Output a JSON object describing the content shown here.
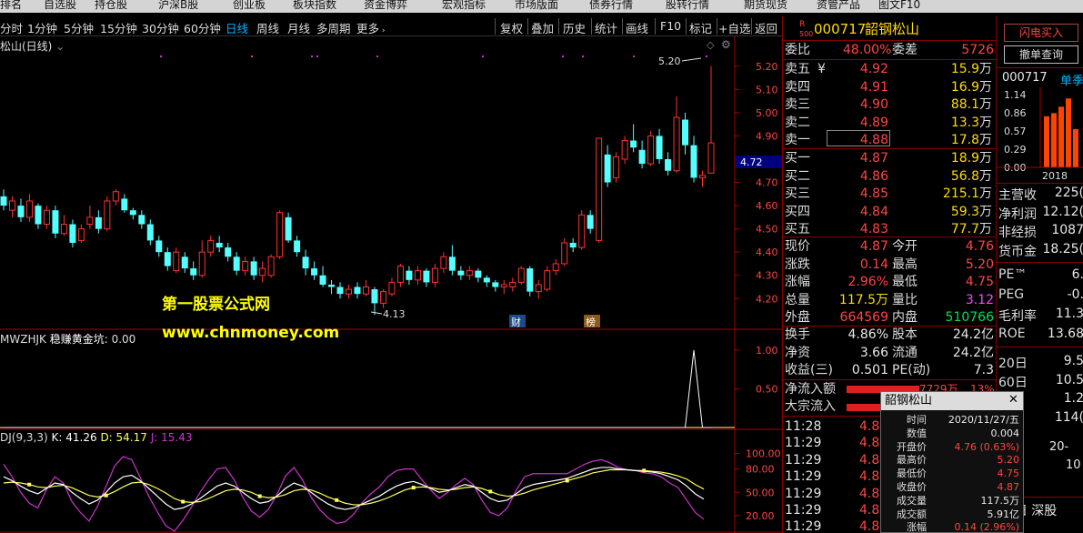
{
  "menubar": {
    "items": [
      "自选股",
      "持仓股",
      "沪深B股",
      "创业板",
      "板块指数",
      "资金博弈",
      "宏观指标",
      "市场版面",
      "债券行情",
      "股转行情",
      "期货现货",
      "资管产品",
      "图文F10"
    ],
    "left_partial": "排名"
  },
  "tabs": {
    "periods": [
      "分时",
      "1分钟",
      "5分钟",
      "15分钟",
      "30分钟",
      "60分钟",
      "日线",
      "周线",
      "月线",
      "多周期",
      "更多"
    ],
    "active": "日线",
    "tools": [
      "复权",
      "叠加",
      "历史",
      "统计",
      "画线",
      "F10",
      "标记",
      "+自选",
      "返回"
    ]
  },
  "chart_header": {
    "name": "松山(日线)"
  },
  "watermark": {
    "line1": "第一股票公式网",
    "line2": "www.chnmoney.com"
  },
  "indicator": {
    "name": "MWZHJK",
    "label": "稳赚黄金坑:",
    "value": "0.00",
    "axis": [
      "1.00",
      "0.50"
    ]
  },
  "kdj": {
    "name": "DJ(9,3,3)",
    "k": "K: 41.26",
    "d": "D: 54.17",
    "j": "J: 15.43",
    "axis": [
      "100.00",
      "80.00",
      "50.00",
      "20.00"
    ]
  },
  "chart_data": {
    "type": "candlestick",
    "price_axis": [
      "5.20",
      "5.10",
      "5.00",
      "4.90",
      "4.80",
      "4.70",
      "4.60",
      "4.50",
      "4.40",
      "4.30",
      "4.20"
    ],
    "ylim": [
      4.115,
      5.25
    ],
    "high_label": "5.20",
    "low_label": "4.13",
    "current_marker": "4.72",
    "event_badges": [
      "财",
      "榜"
    ],
    "candles": [
      [
        4.64,
        4.6,
        4.67,
        4.58
      ],
      [
        4.58,
        4.62,
        4.64,
        4.55
      ],
      [
        4.6,
        4.55,
        4.63,
        4.53
      ],
      [
        4.55,
        4.62,
        4.65,
        4.53
      ],
      [
        4.6,
        4.52,
        4.61,
        4.5
      ],
      [
        4.52,
        4.58,
        4.6,
        4.5
      ],
      [
        4.58,
        4.48,
        4.6,
        4.46
      ],
      [
        4.48,
        4.52,
        4.56,
        4.47
      ],
      [
        4.52,
        4.44,
        4.54,
        4.42
      ],
      [
        4.45,
        4.5,
        4.52,
        4.44
      ],
      [
        4.52,
        4.55,
        4.6,
        4.5
      ],
      [
        4.55,
        4.5,
        4.58,
        4.48
      ],
      [
        4.5,
        4.62,
        4.64,
        4.49
      ],
      [
        4.62,
        4.66,
        4.67,
        4.6
      ],
      [
        4.63,
        4.58,
        4.65,
        4.57
      ],
      [
        4.58,
        4.56,
        4.59,
        4.54
      ],
      [
        4.56,
        4.52,
        4.58,
        4.5
      ],
      [
        4.52,
        4.45,
        4.54,
        4.43
      ],
      [
        4.45,
        4.4,
        4.47,
        4.38
      ],
      [
        4.4,
        4.34,
        4.42,
        4.32
      ],
      [
        4.32,
        4.4,
        4.42,
        4.31
      ],
      [
        4.38,
        4.33,
        4.4,
        4.31
      ],
      [
        4.33,
        4.3,
        4.36,
        4.28
      ],
      [
        4.3,
        4.4,
        4.45,
        4.29
      ],
      [
        4.4,
        4.45,
        4.47,
        4.38
      ],
      [
        4.44,
        4.42,
        4.47,
        4.4
      ],
      [
        4.42,
        4.38,
        4.44,
        4.36
      ],
      [
        4.38,
        4.32,
        4.4,
        4.3
      ],
      [
        4.32,
        4.36,
        4.38,
        4.3
      ],
      [
        4.36,
        4.3,
        4.38,
        4.28
      ],
      [
        4.3,
        4.33,
        4.36,
        4.27
      ],
      [
        4.3,
        4.38,
        4.39,
        4.29
      ],
      [
        4.38,
        4.57,
        4.58,
        4.37
      ],
      [
        4.55,
        4.45,
        4.57,
        4.44
      ],
      [
        4.45,
        4.4,
        4.47,
        4.38
      ],
      [
        4.38,
        4.33,
        4.41,
        4.3
      ],
      [
        4.33,
        4.3,
        4.36,
        4.28
      ],
      [
        4.3,
        4.26,
        4.34,
        4.25
      ],
      [
        4.26,
        4.25,
        4.28,
        4.22
      ],
      [
        4.25,
        4.22,
        4.27,
        4.2
      ],
      [
        4.22,
        4.24,
        4.26,
        4.2
      ],
      [
        4.25,
        4.22,
        4.27,
        4.2
      ],
      [
        4.22,
        4.25,
        4.28,
        4.21
      ],
      [
        4.24,
        4.18,
        4.25,
        4.13
      ],
      [
        4.18,
        4.23,
        4.24,
        4.16
      ],
      [
        4.22,
        4.27,
        4.29,
        4.21
      ],
      [
        4.27,
        4.34,
        4.35,
        4.25
      ],
      [
        4.32,
        4.28,
        4.34,
        4.26
      ],
      [
        4.28,
        4.32,
        4.34,
        4.26
      ],
      [
        4.32,
        4.27,
        4.33,
        4.25
      ],
      [
        4.27,
        4.33,
        4.35,
        4.25
      ],
      [
        4.33,
        4.38,
        4.4,
        4.31
      ],
      [
        4.38,
        4.32,
        4.43,
        4.3
      ],
      [
        4.32,
        4.3,
        4.34,
        4.28
      ],
      [
        4.3,
        4.32,
        4.34,
        4.28
      ],
      [
        4.32,
        4.29,
        4.33,
        4.27
      ],
      [
        4.29,
        4.27,
        4.3,
        4.25
      ],
      [
        4.27,
        4.25,
        4.28,
        4.23
      ],
      [
        4.25,
        4.26,
        4.28,
        4.22
      ],
      [
        4.25,
        4.27,
        4.29,
        4.23
      ],
      [
        4.27,
        4.33,
        4.34,
        4.26
      ],
      [
        4.33,
        4.23,
        4.34,
        4.21
      ],
      [
        4.23,
        4.26,
        4.28,
        4.2
      ],
      [
        4.24,
        4.32,
        4.34,
        4.23
      ],
      [
        4.32,
        4.35,
        4.37,
        4.3
      ],
      [
        4.35,
        4.44,
        4.46,
        4.34
      ],
      [
        4.44,
        4.42,
        4.46,
        4.4
      ],
      [
        4.42,
        4.56,
        4.58,
        4.41
      ],
      [
        4.56,
        4.5,
        4.58,
        4.48
      ],
      [
        4.45,
        4.89,
        4.89,
        4.44
      ],
      [
        4.82,
        4.7,
        4.86,
        4.68
      ],
      [
        4.72,
        4.81,
        4.83,
        4.7
      ],
      [
        4.8,
        4.88,
        4.9,
        4.78
      ],
      [
        4.88,
        4.85,
        4.95,
        4.83
      ],
      [
        4.84,
        4.78,
        4.88,
        4.76
      ],
      [
        4.78,
        4.9,
        4.92,
        4.77
      ],
      [
        4.9,
        4.8,
        4.93,
        4.78
      ],
      [
        4.8,
        4.75,
        4.83,
        4.73
      ],
      [
        4.75,
        4.98,
        5.07,
        4.74
      ],
      [
        4.97,
        4.86,
        5.0,
        4.82
      ],
      [
        4.86,
        4.72,
        4.9,
        4.7
      ],
      [
        4.72,
        4.73,
        4.75,
        4.68
      ],
      [
        4.74,
        4.87,
        5.2,
        4.74
      ]
    ],
    "indicator_series": [
      0,
      0,
      0,
      0,
      0,
      0,
      0,
      0,
      0,
      0,
      0,
      0,
      0,
      0,
      0,
      0,
      0,
      0,
      0,
      0,
      0,
      0,
      0,
      0,
      0,
      0,
      0,
      0,
      0,
      0,
      0,
      0,
      0,
      0,
      0,
      0,
      0,
      0,
      0,
      0,
      0,
      0,
      0,
      0,
      0,
      0,
      0,
      0,
      0,
      0,
      0,
      0,
      0,
      0,
      0,
      0,
      0,
      0,
      0,
      0,
      0,
      0,
      0,
      0,
      0,
      0,
      0,
      0,
      0,
      0,
      0,
      0,
      0,
      0,
      0,
      0,
      0,
      0,
      0,
      0,
      1,
      0,
      0
    ],
    "kdj_series": {
      "K": [
        70,
        65,
        58,
        52,
        48,
        55,
        62,
        60,
        50,
        42,
        35,
        40,
        50,
        62,
        70,
        72,
        65,
        55,
        45,
        35,
        28,
        30,
        35,
        42,
        50,
        58,
        62,
        58,
        50,
        42,
        36,
        38,
        45,
        55,
        62,
        58,
        50,
        42,
        35,
        30,
        28,
        30,
        35,
        40,
        45,
        52,
        58,
        62,
        64,
        60,
        55,
        50,
        52,
        56,
        60,
        58,
        50,
        42,
        38,
        40,
        48,
        56,
        60,
        62,
        64,
        66,
        68,
        72,
        76,
        80,
        82,
        82,
        80,
        79,
        78,
        77,
        76,
        74,
        70,
        66,
        58,
        48,
        41.26
      ],
      "D": [
        62,
        63,
        62,
        60,
        57,
        56,
        58,
        59,
        56,
        51,
        46,
        44,
        46,
        51,
        57,
        62,
        63,
        60,
        55,
        49,
        42,
        38,
        37,
        38,
        42,
        47,
        52,
        54,
        53,
        50,
        45,
        43,
        44,
        47,
        52,
        54,
        53,
        49,
        44,
        40,
        36,
        34,
        34,
        36,
        39,
        43,
        48,
        53,
        56,
        57,
        56,
        54,
        53,
        54,
        56,
        57,
        55,
        51,
        47,
        45,
        46,
        49,
        53,
        56,
        59,
        62,
        65,
        68,
        71,
        75,
        77,
        79,
        79,
        79,
        78,
        78,
        77,
        76,
        74,
        71,
        67,
        60,
        54.17
      ],
      "J": [
        86,
        70,
        50,
        36,
        30,
        53,
        70,
        62,
        38,
        24,
        13,
        32,
        58,
        84,
        96,
        92,
        69,
        45,
        25,
        7,
        0,
        14,
        31,
        50,
        66,
        80,
        82,
        66,
        44,
        26,
        18,
        28,
        47,
        71,
        82,
        66,
        44,
        28,
        17,
        10,
        12,
        22,
        37,
        48,
        57,
        70,
        78,
        80,
        80,
        66,
        53,
        42,
        50,
        60,
        68,
        60,
        40,
        24,
        20,
        30,
        52,
        70,
        74,
        74,
        74,
        74,
        74,
        80,
        86,
        90,
        92,
        88,
        82,
        79,
        78,
        75,
        74,
        70,
        62,
        56,
        40,
        24,
        15.43
      ]
    }
  },
  "quote": {
    "title_prefix": "R",
    "title_sub": "500",
    "code": "000717",
    "name": "韶钢松山",
    "webi_label": "委比",
    "webi": "48.00%",
    "weicha_label": "委差",
    "weicha": "5726",
    "asks": [
      {
        "label": "卖五",
        "price": "4.92",
        "vol": "15.9",
        "unit": "万"
      },
      {
        "label": "卖四",
        "price": "4.91",
        "vol": "16.9",
        "unit": "万"
      },
      {
        "label": "卖三",
        "price": "4.90",
        "vol": "88.1",
        "unit": "万"
      },
      {
        "label": "卖二",
        "price": "4.89",
        "vol": "13.3",
        "unit": "万"
      },
      {
        "label": "卖一",
        "price": "4.88",
        "vol": "17.8",
        "unit": "万"
      }
    ],
    "bids": [
      {
        "label": "买一",
        "price": "4.87",
        "vol": "18.9",
        "unit": "万"
      },
      {
        "label": "买二",
        "price": "4.86",
        "vol": "56.8",
        "unit": "万"
      },
      {
        "label": "买三",
        "price": "4.85",
        "vol": "215.1",
        "unit": "万"
      },
      {
        "label": "买四",
        "price": "4.84",
        "vol": "59.3",
        "unit": "万"
      },
      {
        "label": "买五",
        "price": "4.83",
        "vol": "77.7",
        "unit": "万"
      }
    ],
    "yen_mark": "¥",
    "stats": [
      {
        "l1": "现价",
        "v1": "4.87",
        "l2": "今开",
        "v2": "4.76",
        "c1": "red",
        "c2": "red"
      },
      {
        "l1": "涨跌",
        "v1": "0.14",
        "l2": "最高",
        "v2": "5.20",
        "c1": "red",
        "c2": "red"
      },
      {
        "l1": "涨幅",
        "v1": "2.96%",
        "l2": "最低",
        "v2": "4.75",
        "c1": "red",
        "c2": "red"
      },
      {
        "l1": "总量",
        "v1": "117.5万",
        "l2": "量比",
        "v2": "3.12",
        "c1": "yel",
        "c2": "mag"
      },
      {
        "l1": "外盘",
        "v1": "664569",
        "l2": "内盘",
        "v2": "510766",
        "c1": "red",
        "c2": "grn"
      }
    ],
    "stats2": [
      {
        "l1": "换手",
        "v1": "4.86%",
        "l2": "股本",
        "v2": "24.2亿"
      },
      {
        "l1": "净资",
        "v1": "3.66",
        "l2": "流通",
        "v2": "24.2亿"
      },
      {
        "l1": "收益(三)",
        "v1": "0.501",
        "l2": "PE(动)",
        "v2": "7.3"
      }
    ],
    "flow": [
      {
        "l": "净流入额",
        "v": "7729万",
        "p": "13%"
      },
      {
        "l": "大宗流入",
        "v": "",
        "p": ""
      }
    ],
    "ticks": [
      {
        "t": "11:28",
        "p": "4.8"
      },
      {
        "t": "11:29",
        "p": "4.8"
      },
      {
        "t": "11:29",
        "p": "4.8"
      },
      {
        "t": "11:29",
        "p": "4.8"
      },
      {
        "t": "11:29",
        "p": "4.8"
      },
      {
        "t": "11:29",
        "p": "4.8"
      },
      {
        "t": "11:29",
        "p": "4.8"
      }
    ]
  },
  "popup": {
    "title": "韶钢松山",
    "close": "✕",
    "rows": [
      {
        "k": "时间",
        "v": "2020/11/27/五",
        "c": "wht"
      },
      {
        "k": "数值",
        "v": "0.004",
        "c": "wht"
      },
      {
        "k": "开盘价",
        "v": "4.76 (0.63%)",
        "c": "red"
      },
      {
        "k": "最高价",
        "v": "5.20",
        "c": "red"
      },
      {
        "k": "最低价",
        "v": "4.75",
        "c": "red"
      },
      {
        "k": "收盘价",
        "v": "4.87",
        "c": "red"
      },
      {
        "k": "成交量",
        "v": "117.5万",
        "c": "wht"
      },
      {
        "k": "成交额",
        "v": "5.91亿",
        "c": "wht"
      },
      {
        "k": "涨幅",
        "v": "0.14 (2.96%)",
        "c": "red"
      }
    ]
  },
  "side": {
    "btn1": "闪电买入",
    "btn2": "撤单查询",
    "code": "000717",
    "tab": "单季",
    "bar_axis": [
      "1.14",
      "0.86",
      "0.57",
      "0.29",
      "0.00"
    ],
    "bar_year": "2018",
    "bars": [
      0.8,
      0.85,
      0.95,
      1.08,
      0.6
    ],
    "metrics": [
      {
        "l": "主营收",
        "v": "225("
      },
      {
        "l": "净利润",
        "v": "12.12("
      },
      {
        "l": "非经损",
        "v": "1087"
      },
      {
        "l": "货币金",
        "v": "18.25("
      }
    ],
    "metrics2": [
      {
        "l": "PE™",
        "v": "6."
      },
      {
        "l": "PEG",
        "v": "-0."
      },
      {
        "l": "毛利率",
        "v": "11.3"
      },
      {
        "l": "ROE",
        "v": "13.68"
      }
    ],
    "metrics3": [
      {
        "l": "20日",
        "v": "9.5"
      },
      {
        "l": "60日",
        "v": "10.5"
      },
      {
        "l": "高",
        "v": "1.2"
      },
      {
        "l": "值",
        "v": "114("
      }
    ],
    "misc": [
      "20-",
      "10",
      "期"
    ],
    "bottom": "26日 深股"
  }
}
